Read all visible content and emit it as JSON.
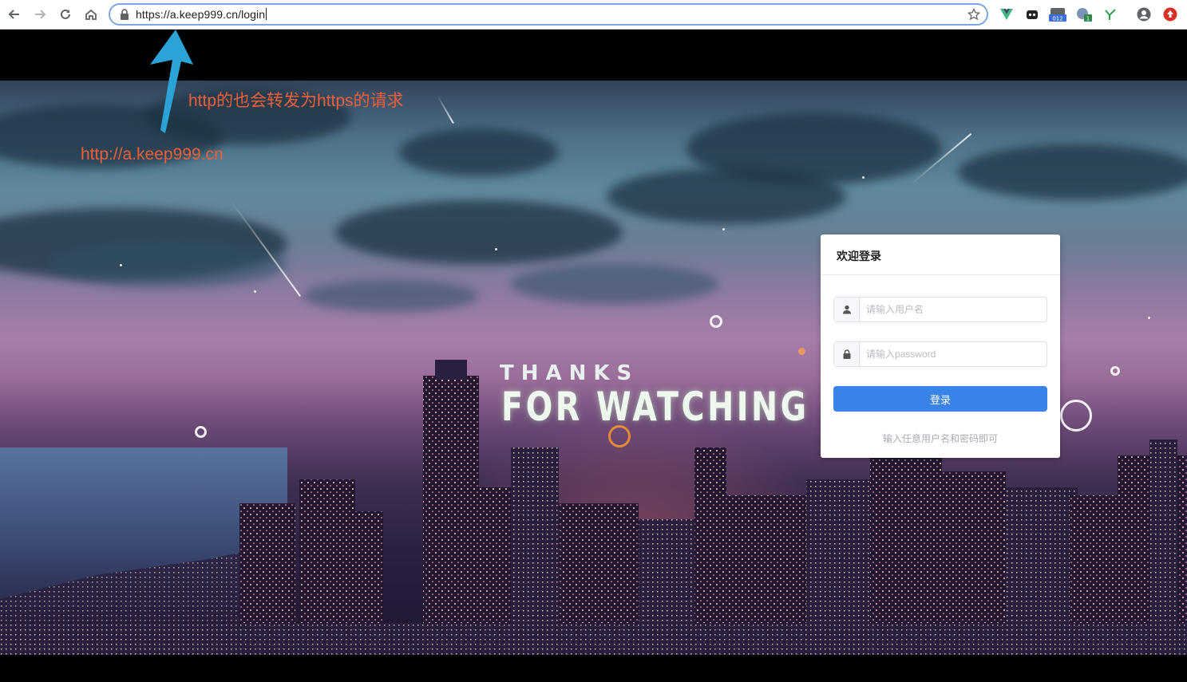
{
  "browser": {
    "url_text": "https://a.keep999.cn/login",
    "extension_badges": {
      "zoom_badge": "012",
      "update_badge": "1"
    }
  },
  "video": {
    "line1": "THANKS",
    "line2": "FOR WATCHING"
  },
  "annotations": {
    "note": "http的也会转发为https的请求",
    "http_url": "http://a.keep999.cn",
    "color": "#f0603a"
  },
  "login": {
    "title": "欢迎登录",
    "username_placeholder": "请输入用户名",
    "password_placeholder": "请输入password",
    "submit_label": "登录",
    "hint": "输入任意用户名和密码即可",
    "accent": "#3a84e9"
  }
}
